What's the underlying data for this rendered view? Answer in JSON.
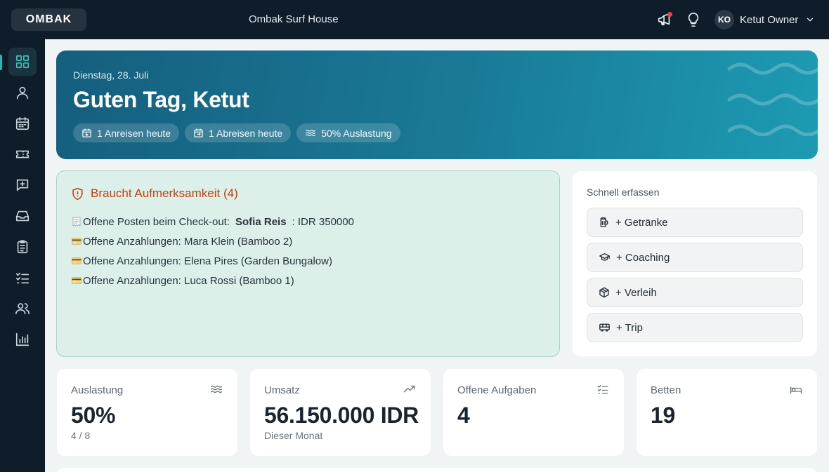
{
  "topbar": {
    "logo": "OMBAK",
    "property": "Ombak Surf House",
    "user": {
      "initials": "KO",
      "name": "Ketut Owner"
    },
    "icons": [
      "megaphone-icon",
      "lightbulb-icon",
      "chevron-down-icon"
    ]
  },
  "sidebar": {
    "items": [
      {
        "icon": "dashboard-icon",
        "active": true
      },
      {
        "icon": "user-icon"
      },
      {
        "icon": "calendar-icon"
      },
      {
        "icon": "ticket-icon"
      },
      {
        "icon": "message-plus-icon"
      },
      {
        "icon": "inbox-icon"
      },
      {
        "icon": "clipboard-icon"
      },
      {
        "icon": "checklist-icon"
      },
      {
        "icon": "users-icon"
      },
      {
        "icon": "chart-icon"
      }
    ]
  },
  "hero": {
    "date": "Dienstag, 28. Juli",
    "greeting": "Guten Tag, Ketut",
    "chips": [
      {
        "icon": "calendar-arrival-icon",
        "label": "1 Anreisen heute"
      },
      {
        "icon": "calendar-departure-icon",
        "label": "1 Abreisen heute"
      },
      {
        "icon": "waves-icon",
        "label": "50% Auslastung"
      }
    ]
  },
  "attention": {
    "title": "Braucht Aufmerksamkeit (4)",
    "items": [
      {
        "emoji": "🧾",
        "text": "Offene Posten beim Check-out:",
        "strong": "Sofia Reis",
        "suffix": ": IDR 350000"
      },
      {
        "emoji": "💳",
        "text": "Offene Anzahlungen: Mara Klein (Bamboo 2)"
      },
      {
        "emoji": "💳",
        "text": "Offene Anzahlungen: Elena Pires (Garden Bungalow)"
      },
      {
        "emoji": "💳",
        "text": "Offene Anzahlungen: Luca Rossi (Bamboo 1)"
      }
    ]
  },
  "quick": {
    "title": "Schnell erfassen",
    "buttons": [
      {
        "icon": "beer-mug-icon",
        "label": "+ Getränke"
      },
      {
        "icon": "graduation-cap-icon",
        "label": "+ Coaching"
      },
      {
        "icon": "box-icon",
        "label": "+ Verleih"
      },
      {
        "icon": "bus-icon",
        "label": "+ Trip"
      }
    ]
  },
  "stats": [
    {
      "label": "Auslastung",
      "value": "50%",
      "sub": "4 / 8",
      "icon": "waves-icon"
    },
    {
      "label": "Umsatz",
      "value": "56.150.000 IDR",
      "sub": "Dieser Monat",
      "icon": "trending-up-icon"
    },
    {
      "label": "Offene Aufgaben",
      "value": "4",
      "sub": "",
      "icon": "checklist-icon"
    },
    {
      "label": "Betten",
      "value": "19",
      "sub": "",
      "icon": "bed-icon"
    }
  ],
  "colors": {
    "topbar": "#0f1d2a",
    "accent": "#2fb3ad",
    "hero_start": "#155e7e",
    "hero_end": "#1d9bb3",
    "attention_bg": "#dcefe9",
    "attention_title": "#c2410c"
  }
}
